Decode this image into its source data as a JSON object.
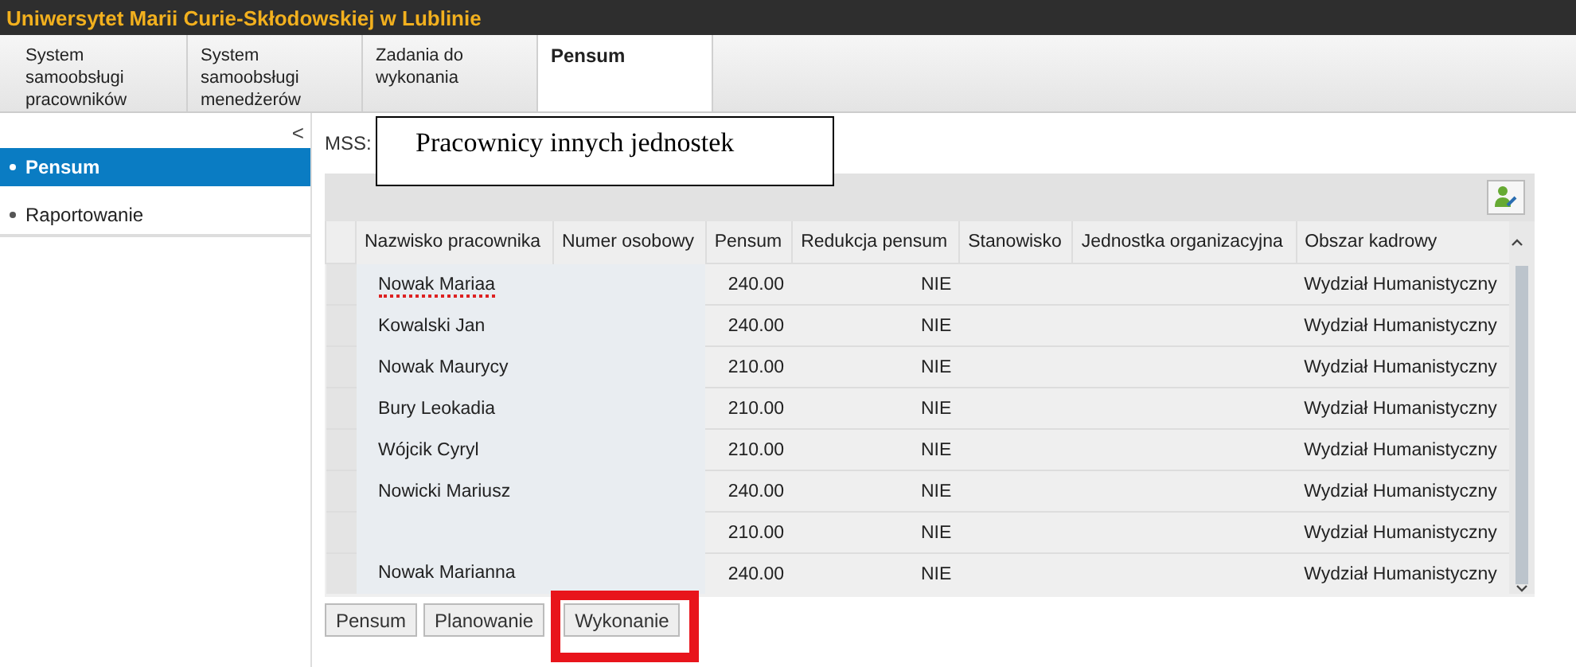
{
  "header": {
    "title": "Uniwersytet Marii Curie-Skłodowskiej w Lublinie"
  },
  "tabs": [
    {
      "label": "System samoobsługi pracowników",
      "selected": false
    },
    {
      "label": "System samoobsługi menedżerów",
      "selected": false
    },
    {
      "label": "Zadania do wykonania",
      "selected": false
    },
    {
      "label": "Pensum",
      "selected": true
    }
  ],
  "sidebar": {
    "collapse": "<",
    "items": [
      {
        "label": "Pensum",
        "selected": true
      },
      {
        "label": "Raportowanie",
        "selected": false
      }
    ]
  },
  "mss_label": "MSS:",
  "callout": "Pracownicy innych jednostek",
  "table": {
    "columns": [
      "Nazwisko pracownika",
      "Numer osobowy",
      "Pensum",
      "Redukcja pensum",
      "Stanowisko",
      "Jednostka organizacyjna",
      "Obszar kadrowy"
    ],
    "rows": [
      {
        "name": "Nowak Mariaa",
        "flagged": true,
        "pensum": "240.00",
        "reduction": "NIE",
        "area": "Wydział Humanistyczny"
      },
      {
        "name": "Kowalski Jan",
        "flagged": false,
        "pensum": "240.00",
        "reduction": "NIE",
        "area": "Wydział Humanistyczny"
      },
      {
        "name": "Nowak Maurycy",
        "flagged": false,
        "pensum": "210.00",
        "reduction": "NIE",
        "area": "Wydział Humanistyczny"
      },
      {
        "name": "Bury Leokadia",
        "flagged": false,
        "pensum": "210.00",
        "reduction": "NIE",
        "area": "Wydział Humanistyczny"
      },
      {
        "name": "Wójcik Cyryl",
        "flagged": false,
        "pensum": "210.00",
        "reduction": "NIE",
        "area": "Wydział Humanistyczny"
      },
      {
        "name": "Nowicki Mariusz",
        "flagged": false,
        "pensum": "240.00",
        "reduction": "NIE",
        "area": "Wydział Humanistyczny"
      },
      {
        "pensum": "210.00",
        "reduction": "NIE",
        "area": "Wydział Humanistyczny"
      },
      {
        "name": "Nowak Marianna",
        "flagged": false,
        "pensum": "240.00",
        "reduction": "NIE",
        "area": "Wydział Humanistyczny"
      }
    ]
  },
  "buttons": [
    {
      "label": "Pensum",
      "highlighted": false
    },
    {
      "label": "Planowanie",
      "highlighted": false
    },
    {
      "label": "Wykonanie",
      "highlighted": true
    }
  ]
}
